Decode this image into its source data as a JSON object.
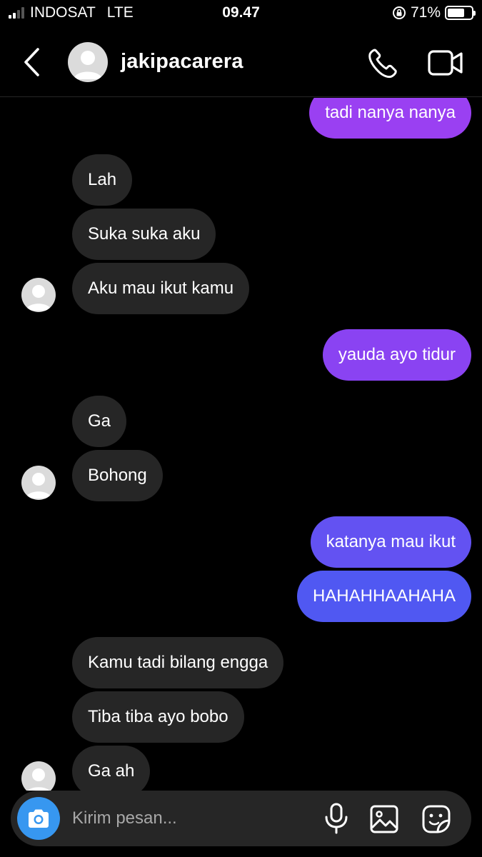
{
  "status_bar": {
    "carrier": "INDOSAT",
    "network": "LTE",
    "time": "09.47",
    "battery_percent": "71%",
    "battery_level": 0.71
  },
  "header": {
    "username": "jakipacarera"
  },
  "colors": {
    "background": "#000000",
    "incoming_bubble": "#262626",
    "outgoing_gradient_top": "#9b3ff2",
    "outgoing_gradient_bottom": "#4f5ef2",
    "camera_button": "#3797f0"
  },
  "messages": [
    {
      "side": "out",
      "text": "tadi nanya nanya"
    },
    {
      "side": "in",
      "text": "Lah"
    },
    {
      "side": "in",
      "text": "Suka suka aku"
    },
    {
      "side": "in",
      "text": "Aku mau ikut kamu"
    },
    {
      "side": "out",
      "text": "yauda ayo tidur"
    },
    {
      "side": "in",
      "text": "Ga"
    },
    {
      "side": "in",
      "text": "Bohong"
    },
    {
      "side": "out",
      "text": "katanya mau ikut"
    },
    {
      "side": "out",
      "text": "HAHAHHAAHAHA"
    },
    {
      "side": "in",
      "text": "Kamu tadi bilang engga"
    },
    {
      "side": "in",
      "text": "Tiba tiba ayo bobo"
    },
    {
      "side": "in",
      "text": "Ga ah"
    }
  ],
  "composer": {
    "placeholder": "Kirim pesan..."
  },
  "icons": {
    "back": "chevron-left-icon",
    "call": "phone-icon",
    "video": "video-camera-icon",
    "camera": "camera-icon",
    "mic": "microphone-icon",
    "gallery": "image-icon",
    "sticker": "sticker-icon"
  }
}
